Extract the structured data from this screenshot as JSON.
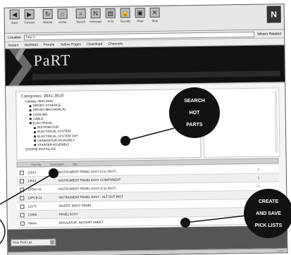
{
  "toolbar": {
    "buttons": [
      {
        "icon": "back-icon",
        "label": "Back"
      },
      {
        "icon": "forward-icon",
        "label": "Forward"
      },
      {
        "icon": "reload-icon",
        "label": "Reload"
      },
      {
        "icon": "home-icon",
        "label": "Home"
      },
      {
        "icon": "search-icon",
        "label": "Search"
      },
      {
        "icon": "netscape-icon",
        "label": "Netscape"
      },
      {
        "icon": "print-icon",
        "label": "Print"
      },
      {
        "icon": "security-icon",
        "label": "Security"
      },
      {
        "icon": "shop-icon",
        "label": "Shop"
      },
      {
        "icon": "stop-icon",
        "label": "Stop"
      }
    ]
  },
  "address_bar": {
    "label": "Location",
    "value": "http://",
    "related": "What's Related"
  },
  "links_bar": [
    "Instant",
    "WebMail",
    "People",
    "Yellow Pages",
    "Download",
    "Channels"
  ],
  "banner": {
    "logo": "PaRT",
    "nav": [
      "",
      "",
      "",
      "",
      "",
      ""
    ]
  },
  "tree": {
    "title": "Categories: 3941 3919",
    "lines": [
      {
        "level": "l1",
        "text": "Catalog: 3941-3919"
      },
      {
        "level": "l2",
        "text": "DRIVES SYNERGE"
      },
      {
        "level": "l2",
        "text": "DRIVES MECHANICAL"
      },
      {
        "level": "l2",
        "text": "COOLING"
      },
      {
        "level": "l2",
        "text": "CABLE"
      },
      {
        "level": "l2",
        "text": "ELECTRICAL"
      },
      {
        "level": "l3",
        "text": "DISTRIBUTOR"
      },
      {
        "level": "l3",
        "text": "ELECTRICAL SYSTEM"
      },
      {
        "level": "l3",
        "text": "ELECTRICAL SYSTEM S/IH"
      },
      {
        "level": "l3",
        "text": "GENERATOR ASSEMBLY"
      },
      {
        "level": "l3",
        "text": "STARTER ASSEMBLY"
      },
      {
        "level": "l1",
        "text": "ENGINE INSTALLED"
      }
    ]
  },
  "side_text": "",
  "table": {
    "headers": [
      "Part No.",
      "Description",
      "Qty"
    ],
    "rows": [
      {
        "pn": "12014",
        "desc": "INSTRUMENT PANEL ASSY (C11 INST)",
        "qty": "1"
      },
      {
        "pn": "13014",
        "desc": "INSTRUMENT PANEL ASSY COMPONENT",
        "qty": "1"
      },
      {
        "pn": "13TAC-11",
        "desc": "INSTRUMENT PANEL ASSY (C11 INST)",
        "qty": "1"
      },
      {
        "pn": "13PCB-11",
        "desc": "INSTRUMENT PANEL ASSY - ALT OUT INST",
        "qty": "1"
      },
      {
        "pn": "12171",
        "desc": "INSERT, BODY PANEL",
        "qty": "1"
      },
      {
        "pn": "13566",
        "desc": "PANEL ASSY",
        "qty": "1"
      },
      {
        "pn": "Select",
        "desc": "INSULATOR, INSTANT SHEET",
        "qty": "1"
      }
    ]
  },
  "pick_list": {
    "label": "",
    "value": "New Pick List"
  },
  "callouts": {
    "search": [
      "SEARCH",
      "HOT",
      "PARTS"
    ],
    "pick": [
      "CREATE",
      "AND SAVE",
      "PICK LISTS"
    ]
  }
}
